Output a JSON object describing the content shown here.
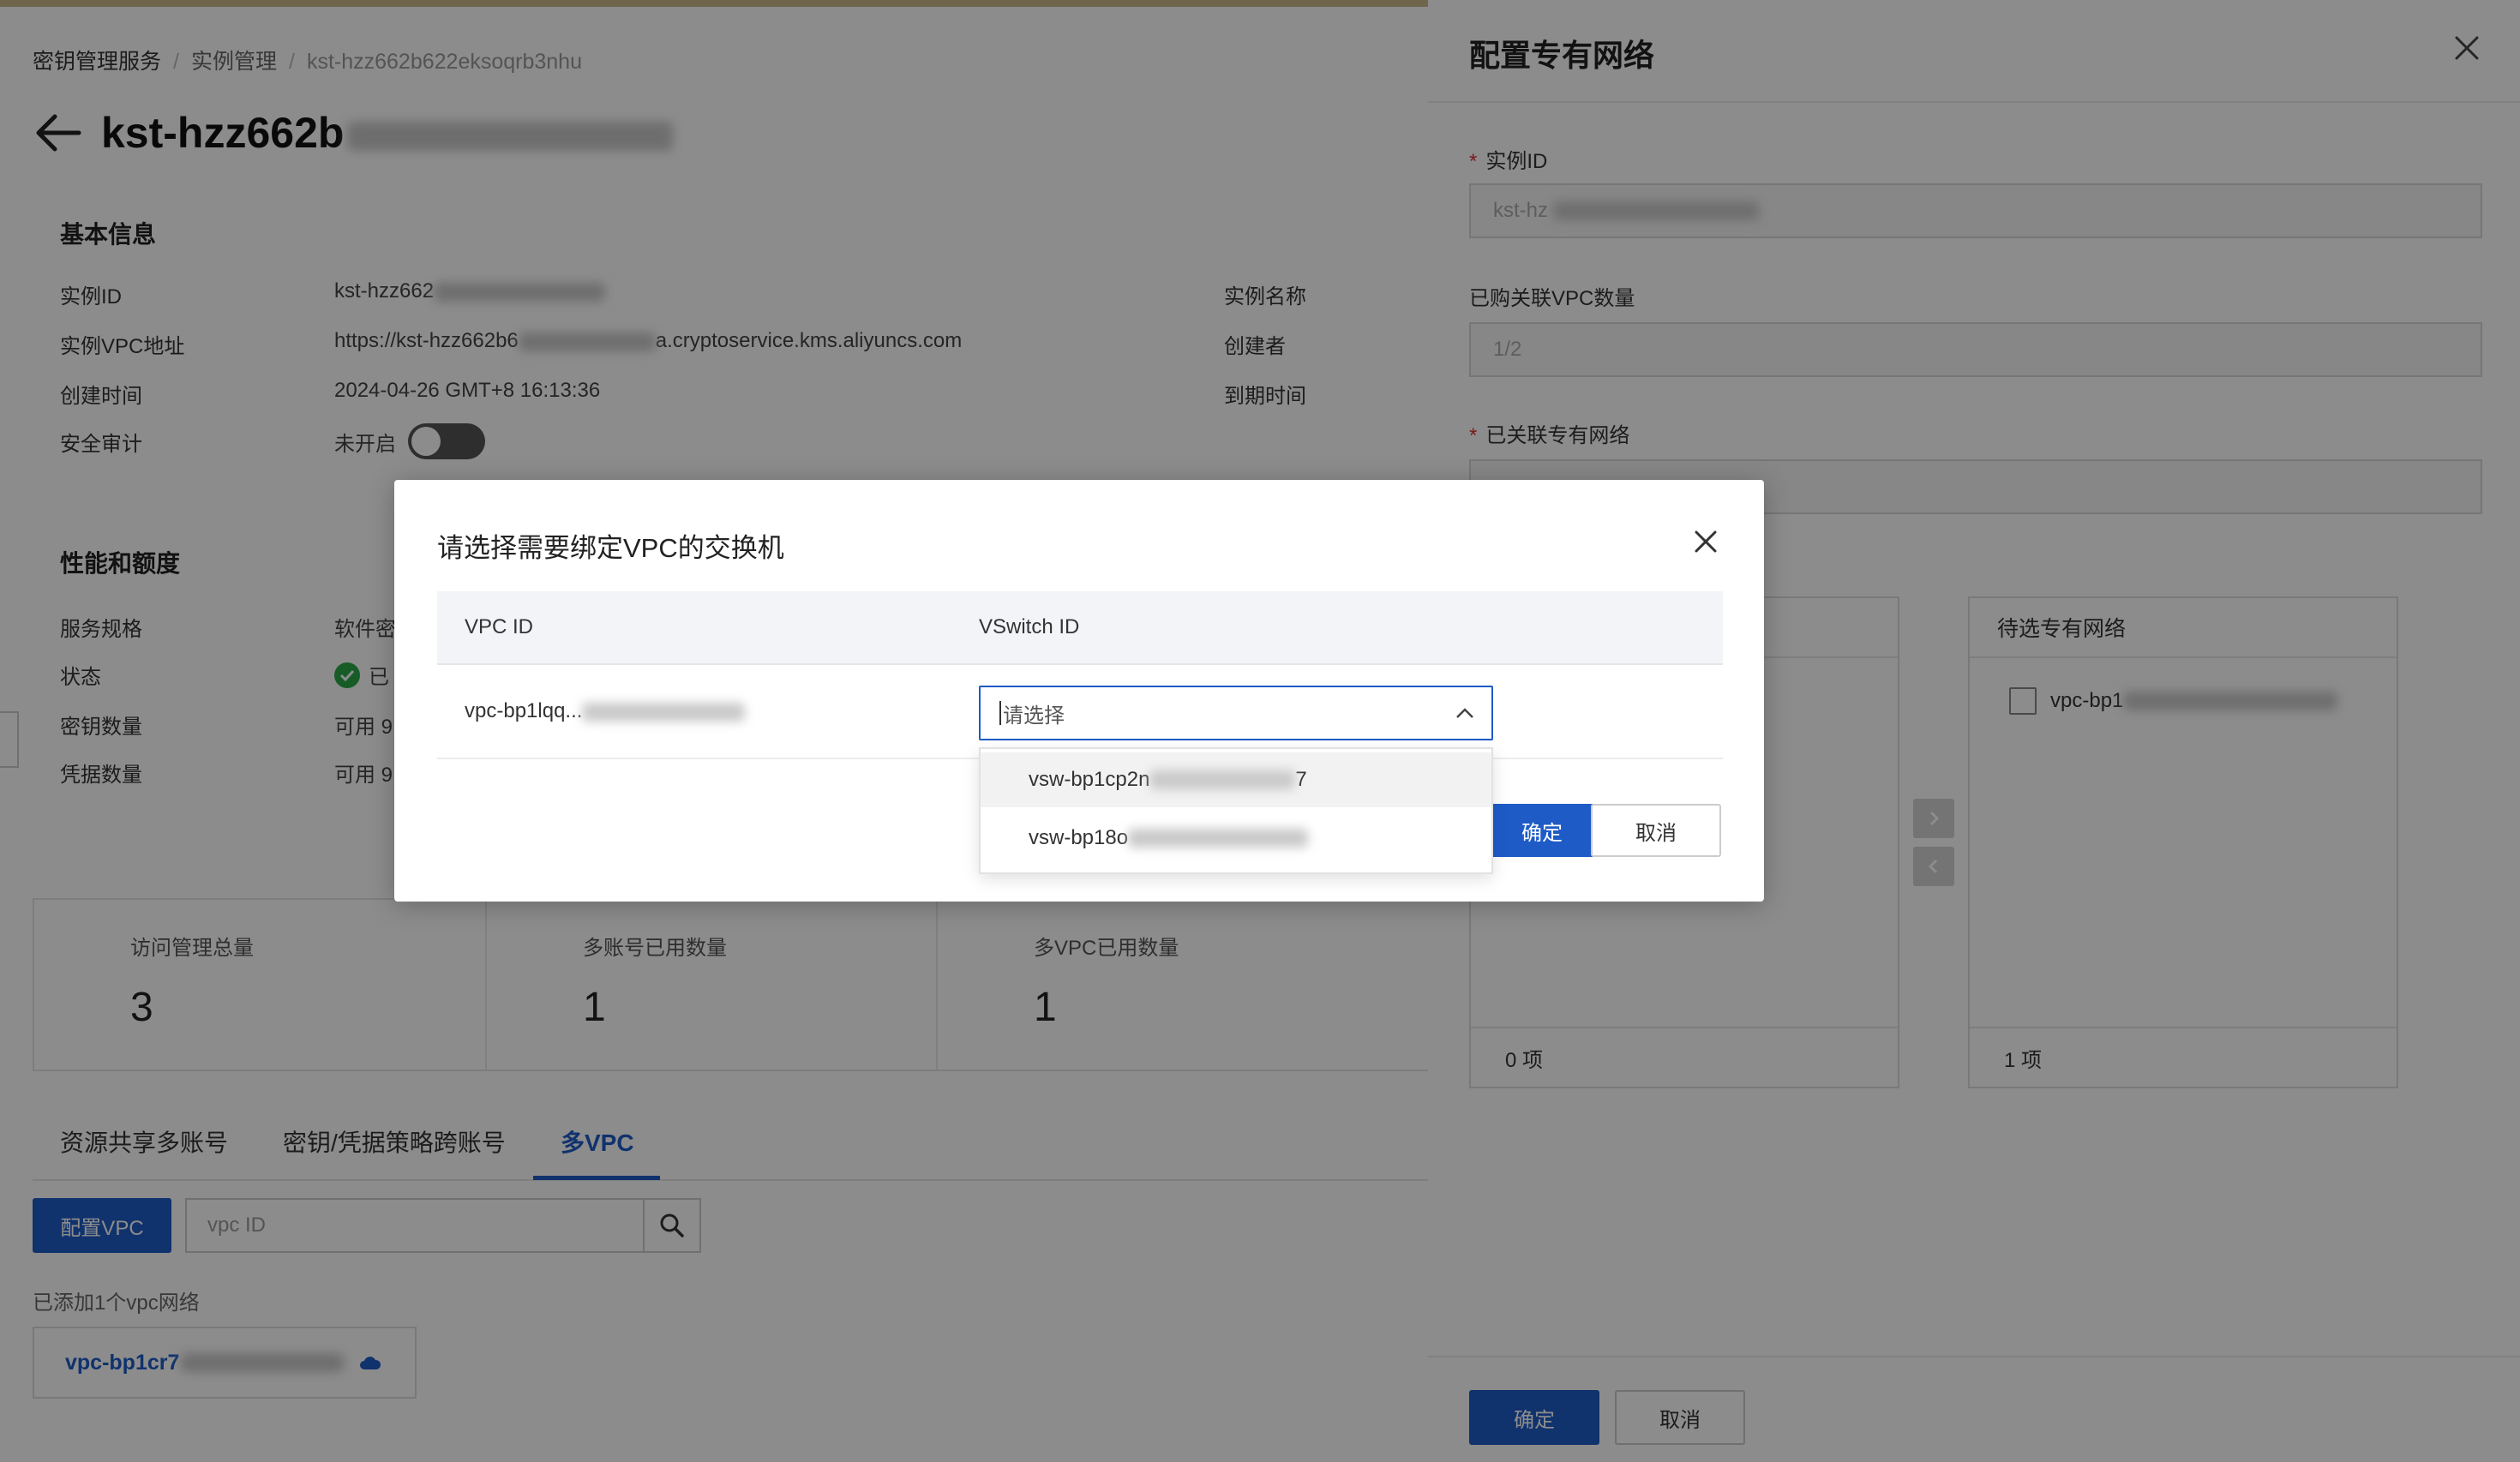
{
  "breadcrumb": {
    "items": [
      "密钥管理服务",
      "实例管理",
      "kst-hzz662b622eksoqrb3nhu"
    ]
  },
  "page": {
    "title_visible": "kst-hzz662b"
  },
  "basic_info": {
    "section_title": "基本信息",
    "rows": [
      {
        "key": "实例ID",
        "value": "kst-hzz662"
      },
      {
        "key": "实例VPC地址",
        "value": "https://kst-hzz662b6",
        "value_tail": "a.cryptoservice.kms.aliyuncs.com"
      },
      {
        "key": "创建时间",
        "value": "2024-04-26 GMT+8 16:13:36"
      },
      {
        "key": "安全审计",
        "value": "未开启"
      }
    ],
    "right_keys": [
      "实例名称",
      "创建者",
      "到期时间"
    ]
  },
  "performance": {
    "section_title": "性能和额度",
    "rows": [
      {
        "key": "服务规格",
        "value": "软件密"
      },
      {
        "key": "状态",
        "value": "已"
      },
      {
        "key": "密钥数量",
        "value": "可用 9"
      },
      {
        "key": "凭据数量",
        "value": "可用 9"
      }
    ]
  },
  "stats": [
    {
      "label": "访问管理总量",
      "value": "3"
    },
    {
      "label": "多账号已用数量",
      "value": "1"
    },
    {
      "label": "多VPC已用数量",
      "value": "1"
    }
  ],
  "tabs": [
    {
      "label": "资源共享多账号"
    },
    {
      "label": "密钥/凭据策略跨账号"
    },
    {
      "label": "多VPC"
    }
  ],
  "toolbar": {
    "config_vpc_label": "配置VPC",
    "search_placeholder": "vpc ID"
  },
  "vpc_list": {
    "count_text": "已添加1个vpc网络",
    "items": [
      {
        "id": "vpc-bp1cr7"
      }
    ]
  },
  "drawer": {
    "title": "配置专有网络",
    "instance_id_label": "实例ID",
    "instance_id_value": "kst-hz",
    "purchased_label": "已购关联VPC数量",
    "purchased_value": "1/2",
    "associated_label": "已关联专有网络",
    "left_box": {
      "count": "0 项"
    },
    "right_box": {
      "title": "待选专有网络",
      "count": "1 项",
      "items": [
        {
          "id": "vpc-bp1"
        }
      ]
    },
    "confirm_label": "确定",
    "cancel_label": "取消"
  },
  "modal": {
    "title": "请选择需要绑定VPC的交换机",
    "columns": [
      "VPC ID",
      "VSwitch ID"
    ],
    "row": {
      "vpc_id": "vpc-bp1lqq..."
    },
    "select_placeholder": "请选择",
    "options": [
      {
        "label": "vsw-bp1cp2n",
        "tail": "7"
      },
      {
        "label": "vsw-bp18o"
      }
    ],
    "confirm_label": "确定",
    "cancel_label": "取消"
  },
  "colors": {
    "primary": "#1e5bc6",
    "required": "#d9302c",
    "success": "#2aa845"
  }
}
